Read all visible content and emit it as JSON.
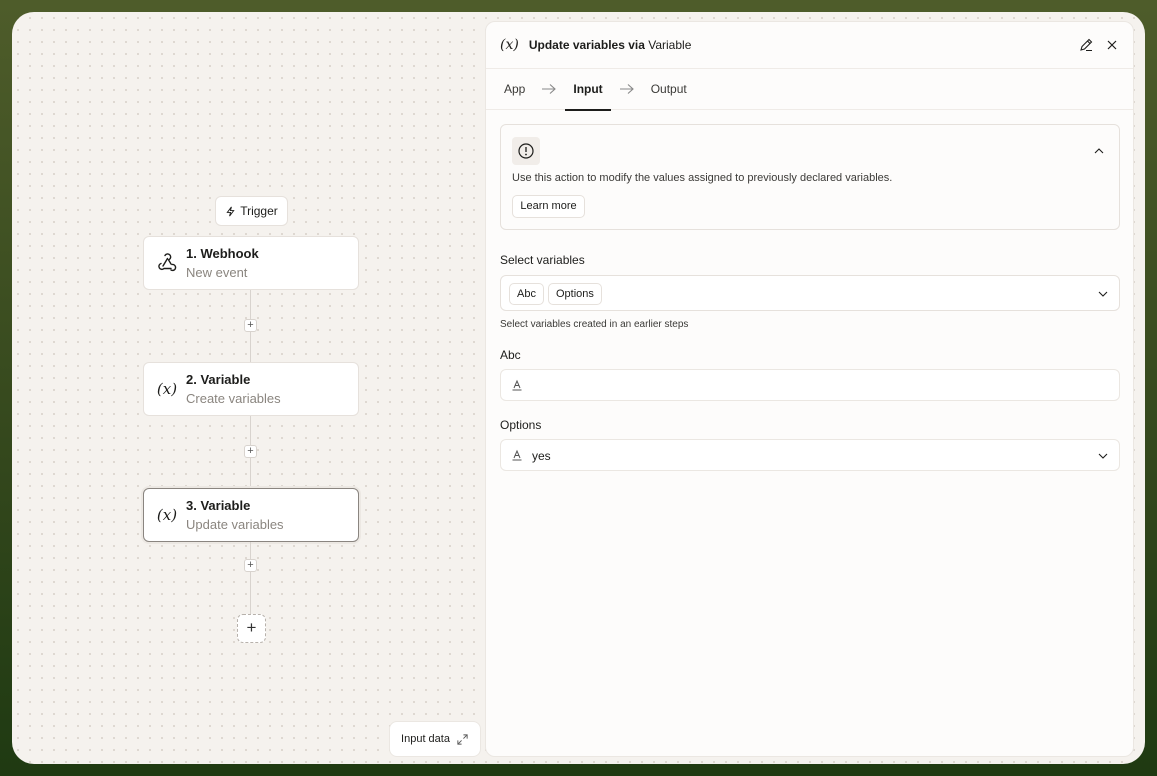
{
  "flow": {
    "trigger_label": "Trigger",
    "steps": [
      {
        "title": "1. Webhook",
        "subtitle": "New event",
        "icon": "webhook-icon"
      },
      {
        "title": "2. Variable",
        "subtitle": "Create variables",
        "icon": "variable-icon",
        "icon_glyph": "(x)"
      },
      {
        "title": "3. Variable",
        "subtitle": "Update variables",
        "icon": "variable-icon",
        "icon_glyph": "(x)"
      }
    ],
    "add_glyph": "+"
  },
  "input_data_button": "Input data",
  "panel": {
    "icon_glyph": "(x)",
    "title": "Update variables via",
    "app_name": "Variable",
    "tabs": [
      "App",
      "Input",
      "Output"
    ],
    "active_tab": "Input",
    "info": {
      "text": "Use this action to modify the values assigned to previously declared variables.",
      "learn_more": "Learn more"
    },
    "select_variables": {
      "label": "Select variables",
      "tags": [
        "Abc",
        "Options"
      ],
      "hint": "Select variables created in an earlier steps"
    },
    "abc": {
      "label": "Abc",
      "value": ""
    },
    "options": {
      "label": "Options",
      "value": "yes"
    }
  }
}
